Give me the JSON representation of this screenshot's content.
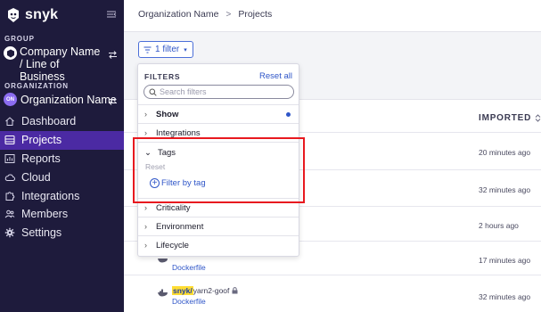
{
  "sidebar": {
    "brand": "snyk",
    "group_label": "GROUP",
    "group_name": "Company Name / Line of Business",
    "org_label": "ORGANIZATION",
    "org_avatar": "ON",
    "org_name": "Organization Name",
    "items": [
      {
        "label": "Dashboard",
        "icon": "home-icon"
      },
      {
        "label": "Projects",
        "icon": "list-icon",
        "active": true
      },
      {
        "label": "Reports",
        "icon": "chart-icon"
      },
      {
        "label": "Cloud",
        "icon": "cloud-icon"
      },
      {
        "label": "Integrations",
        "icon": "puzzle-icon"
      },
      {
        "label": "Members",
        "icon": "people-icon"
      },
      {
        "label": "Settings",
        "icon": "gear-icon"
      }
    ]
  },
  "breadcrumb": {
    "org": "Organization Name",
    "separator": ">",
    "page": "Projects"
  },
  "filter_button": {
    "label": "1 filter"
  },
  "filters_panel": {
    "title": "FILTERS",
    "reset_all": "Reset all",
    "search_placeholder": "Search filters",
    "sections": [
      {
        "label": "Show",
        "active_dot": true
      },
      {
        "label": "Integrations"
      },
      {
        "label": "Tags",
        "expanded": true,
        "reset": "Reset",
        "action": "Filter by tag"
      },
      {
        "label": "Criticality"
      },
      {
        "label": "Environment"
      },
      {
        "label": "Lifecycle"
      }
    ]
  },
  "table": {
    "imported_header": "IMPORTED",
    "times": [
      "20 minutes ago",
      "32 minutes ago",
      "2 hours ago",
      "17 minutes ago",
      "32 minutes ago"
    ],
    "visible_projects": [
      {
        "file": "Dockerfile"
      },
      {
        "owner": "snyk/",
        "repo": "yarn2-goof",
        "file": "Dockerfile"
      }
    ]
  },
  "colors": {
    "sidebar_bg": "#1e1b3c",
    "active_nav": "#4b2aa3",
    "link": "#2f56c8",
    "highlight": "#e8191f"
  }
}
